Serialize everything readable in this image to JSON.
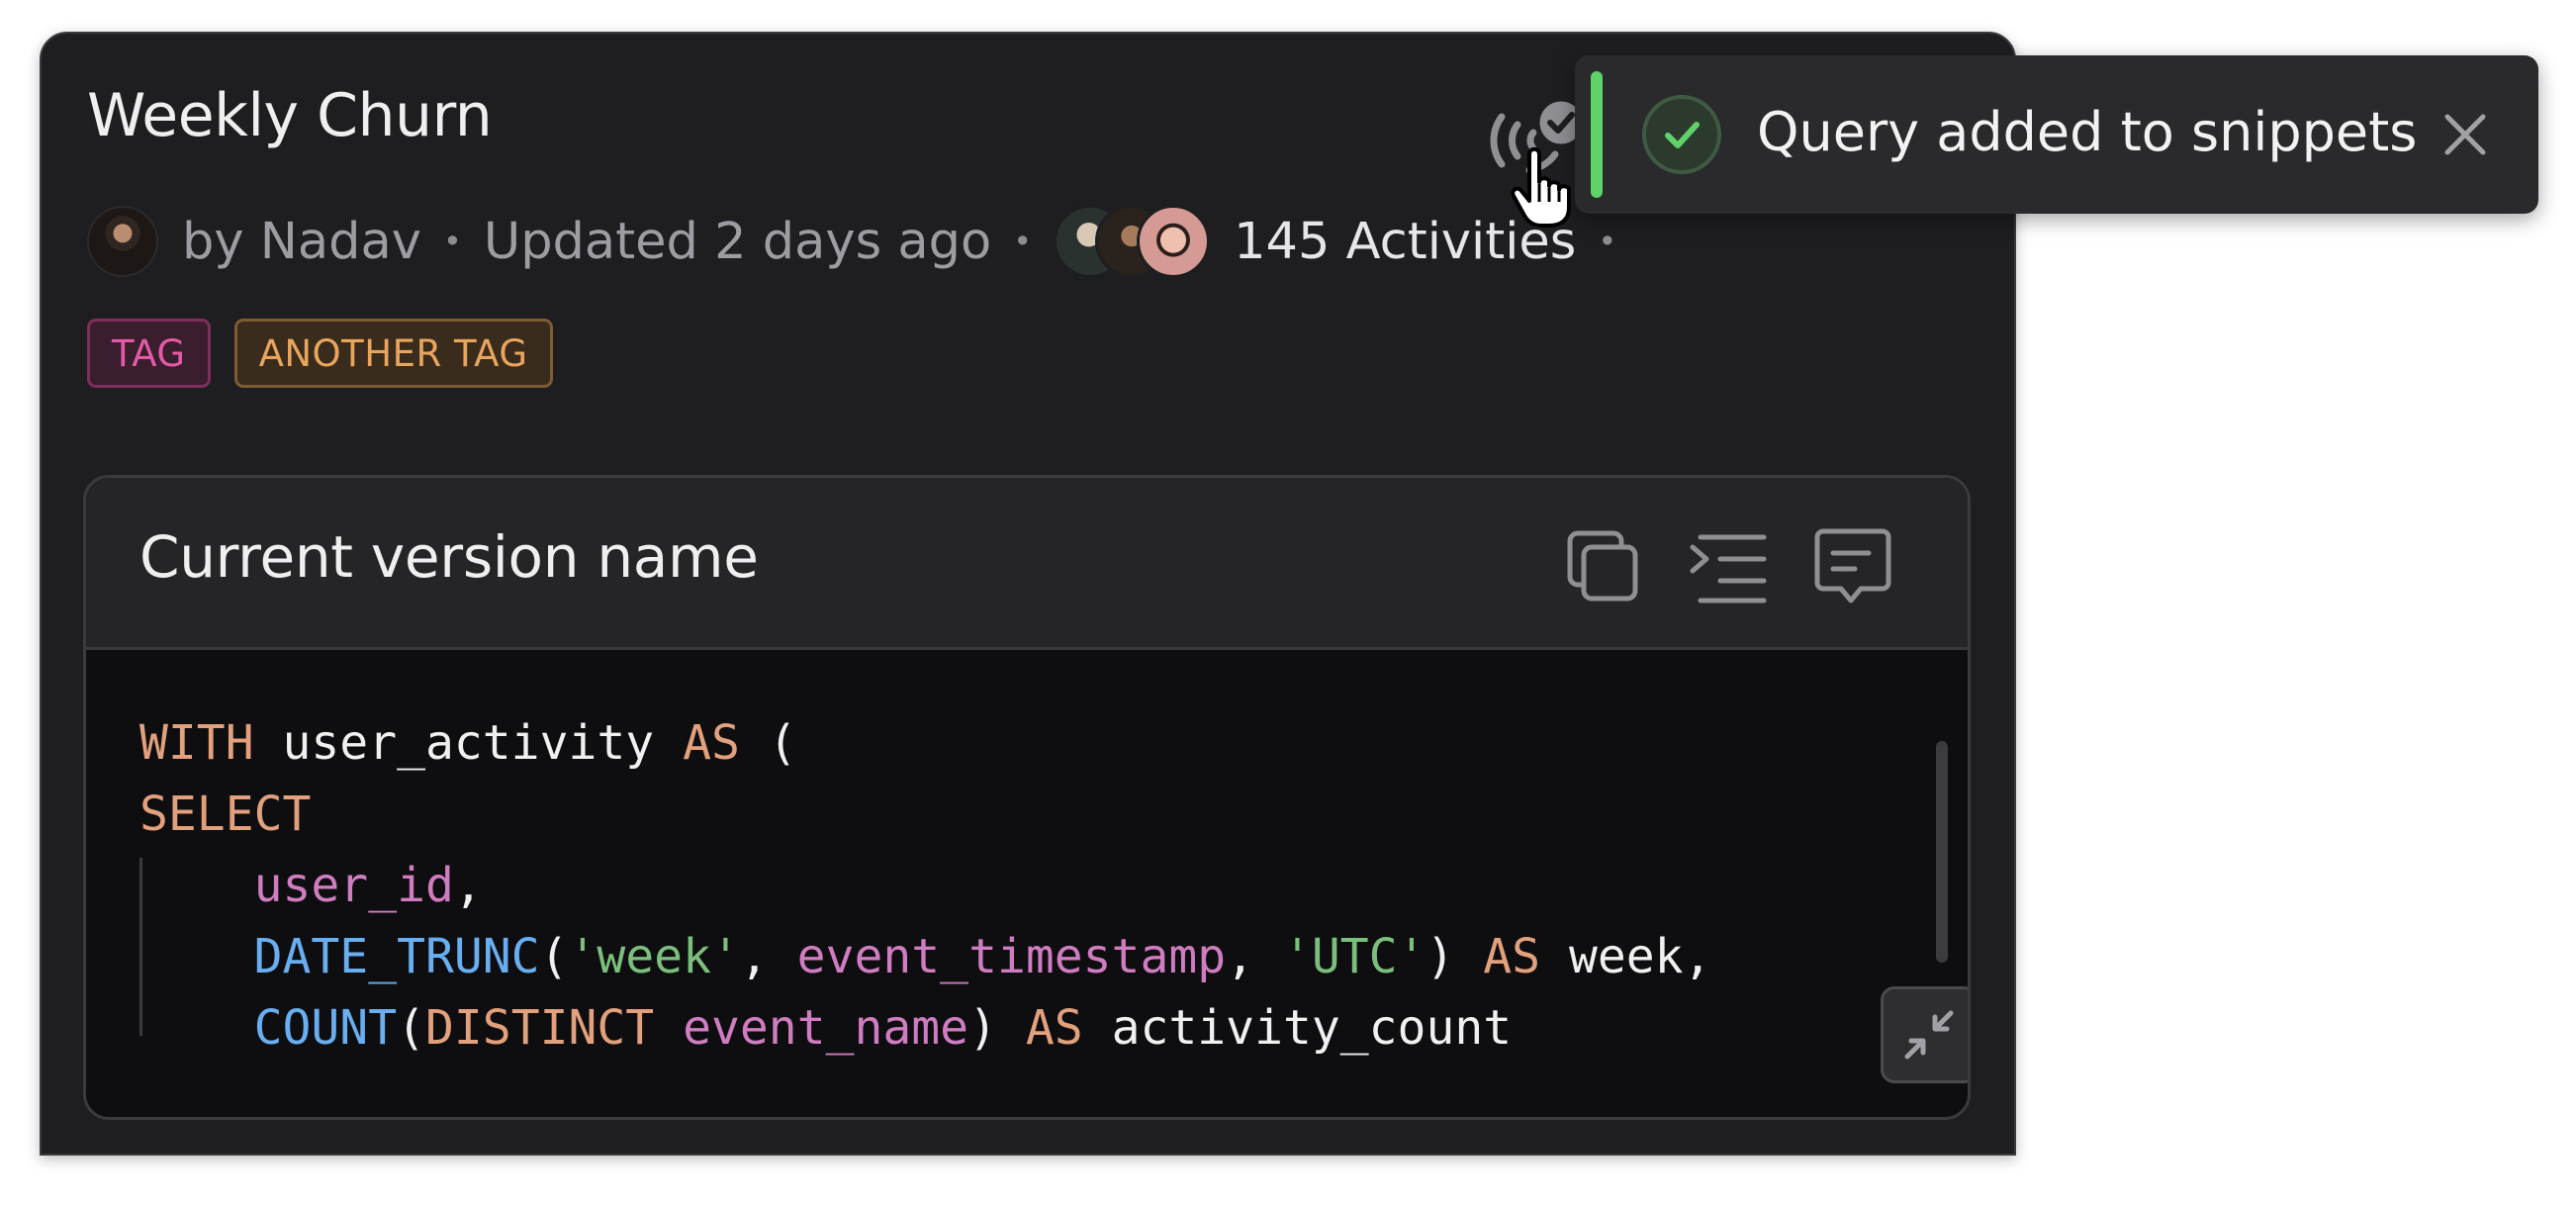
{
  "card": {
    "title": "Weekly Churn",
    "author": "by Nadav",
    "updated": "Updated 2 days ago",
    "activities": "145 Activities",
    "separator": "•",
    "tags": [
      "TAG",
      "ANOTHER TAG"
    ]
  },
  "toolbar_icons": {
    "broadcast": "broadcast-check-icon",
    "copy": "copy-icon",
    "indent": "indent-icon",
    "comment": "comment-icon",
    "collapse": "collapse-icon"
  },
  "panel": {
    "title": "Current version name",
    "code_lines": [
      [
        {
          "t": "WITH",
          "c": "kw"
        },
        {
          "t": " user_activity ",
          "c": ""
        },
        {
          "t": "AS",
          "c": "kw"
        },
        {
          "t": " (",
          "c": ""
        }
      ],
      [
        {
          "t": "SELECT",
          "c": "kw"
        }
      ],
      [
        {
          "t": "    ",
          "c": ""
        },
        {
          "t": "user_id",
          "c": "col"
        },
        {
          "t": ",",
          "c": ""
        }
      ],
      [
        {
          "t": "    ",
          "c": ""
        },
        {
          "t": "DATE_TRUNC",
          "c": "fn"
        },
        {
          "t": "(",
          "c": ""
        },
        {
          "t": "'week'",
          "c": "str"
        },
        {
          "t": ", ",
          "c": ""
        },
        {
          "t": "event_timestamp",
          "c": "col"
        },
        {
          "t": ", ",
          "c": ""
        },
        {
          "t": "'UTC'",
          "c": "str"
        },
        {
          "t": ") ",
          "c": ""
        },
        {
          "t": "AS",
          "c": "kw"
        },
        {
          "t": " week,",
          "c": ""
        }
      ],
      [
        {
          "t": "    ",
          "c": ""
        },
        {
          "t": "COUNT",
          "c": "fn"
        },
        {
          "t": "(",
          "c": ""
        },
        {
          "t": "DISTINCT",
          "c": "kw"
        },
        {
          "t": " ",
          "c": ""
        },
        {
          "t": "event_name",
          "c": "col"
        },
        {
          "t": ") ",
          "c": ""
        },
        {
          "t": "AS",
          "c": "kw"
        },
        {
          "t": " activity_count",
          "c": ""
        }
      ]
    ]
  },
  "toast": {
    "message": "Query added to snippets",
    "status_color": "#5fd36a"
  },
  "colors": {
    "background": "#1e1e21",
    "keyword": "#e2a07c",
    "function": "#68aef0",
    "column": "#cf7cc0",
    "string": "#7cbf7c"
  }
}
